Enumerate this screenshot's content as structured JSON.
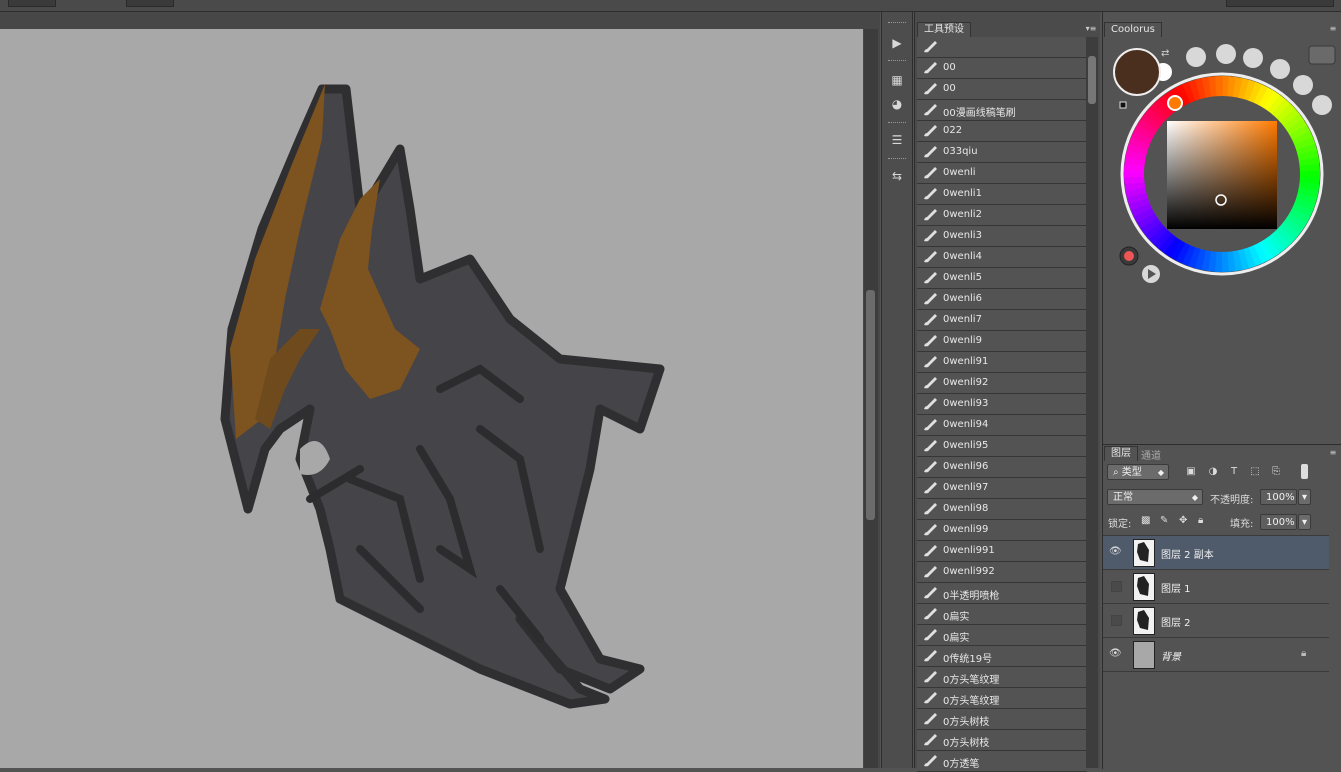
{
  "options_bar": {},
  "toolbar_strip": {
    "icons": [
      "play-icon",
      "grid-icon",
      "palette-icon",
      "sliders-icon",
      "brush-swap-icon"
    ]
  },
  "tool_presets": {
    "tab_label": "工具预设",
    "items": [
      "",
      "00",
      "00",
      "00漫画线稿笔刷",
      "022",
      "033qiu",
      "0wenli",
      "0wenli1",
      "0wenli2",
      "0wenli3",
      "0wenli4",
      "0wenli5",
      "0wenli6",
      "0wenli7",
      "0wenli9",
      "0wenli91",
      "0wenli92",
      "0wenli93",
      "0wenli94",
      "0wenli95",
      "0wenli96",
      "0wenli97",
      "0wenli98",
      "0wenli99",
      "0wenli991",
      "0wenli992",
      "0半透明喷枪",
      "0扁实",
      "0扁实",
      "0传统19号",
      "0方头笔纹理",
      "0方头笔纹理",
      "0方头树枝",
      "0方头树枝",
      "0方透笔"
    ]
  },
  "coolorus": {
    "tab_label": "Coolorus",
    "foreground_color": "#4a2e1e",
    "background_color": "#ffffff",
    "hue_color": "#ff7a00"
  },
  "layers": {
    "tabs": [
      "图层",
      "通道"
    ],
    "filter_label": "类型",
    "blend_mode": "正常",
    "opacity_label": "不透明度:",
    "opacity_value": "100%",
    "lock_label": "锁定:",
    "fill_label": "填充:",
    "fill_value": "100%",
    "rows": [
      {
        "name": "图层 2 副本",
        "visible": true,
        "selected": true
      },
      {
        "name": "图层 1",
        "visible": false,
        "selected": false
      },
      {
        "name": "图层 2",
        "visible": false,
        "selected": false
      },
      {
        "name": "背景",
        "visible": true,
        "selected": false,
        "locked": true
      }
    ]
  },
  "colors": {
    "canvas": "#a8a8a8",
    "selection": "#4f5a6b",
    "accent_orange": "#8a5a1e"
  }
}
